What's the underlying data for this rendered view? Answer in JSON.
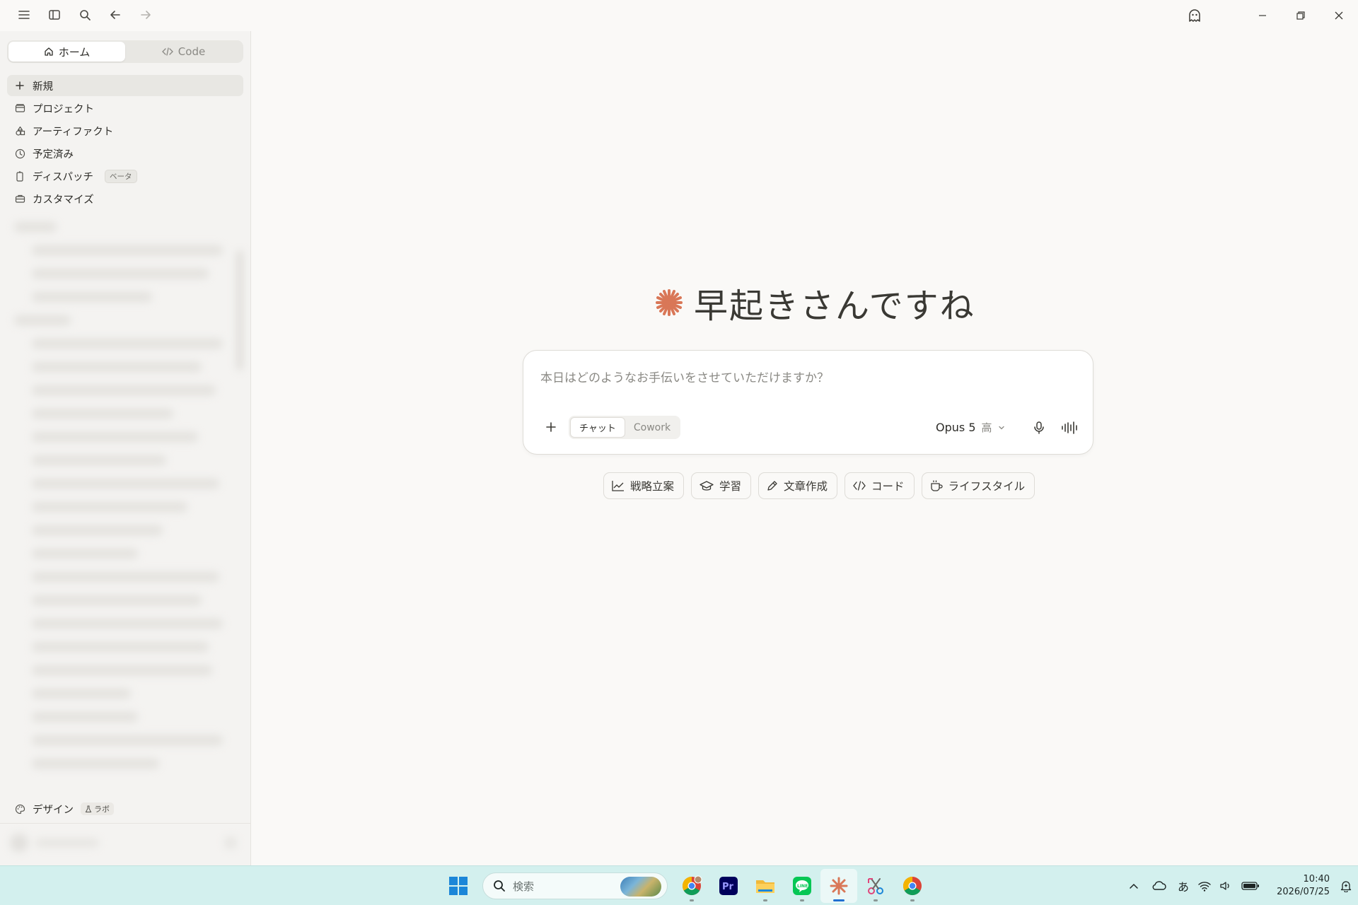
{
  "sidebar": {
    "segment": {
      "home_label": "ホーム",
      "code_label": "Code"
    },
    "items": [
      {
        "label": "新規",
        "icon": "plus-icon"
      },
      {
        "label": "プロジェクト",
        "icon": "folder-icon"
      },
      {
        "label": "アーティファクト",
        "icon": "shapes-icon"
      },
      {
        "label": "予定済み",
        "icon": "clock-icon"
      },
      {
        "label": "ディスパッチ",
        "icon": "phone-icon",
        "badge": "ベータ"
      },
      {
        "label": "カスタマイズ",
        "icon": "briefcase-icon"
      }
    ],
    "design": {
      "label": "デザイン",
      "badge": "ラボ"
    }
  },
  "main": {
    "greeting": "早起きさんですね",
    "composer": {
      "placeholder": "本日はどのようなお手伝いをさせていただけますか？",
      "modes": [
        "チャット",
        "Cowork"
      ],
      "active_mode": "チャット",
      "model": "Opus 5",
      "effort": "高"
    },
    "chips": [
      "戦略立案",
      "学習",
      "文章作成",
      "コード",
      "ライフスタイル"
    ]
  },
  "taskbar": {
    "search_placeholder": "検索",
    "ime": "あ",
    "time": "10:40",
    "date": "2026/07/25"
  },
  "colors": {
    "accent": "#d97757",
    "background": "#faf9f7",
    "sidebar_bg": "#f4f3f1",
    "taskbar_bg": "#d3f0ee"
  }
}
